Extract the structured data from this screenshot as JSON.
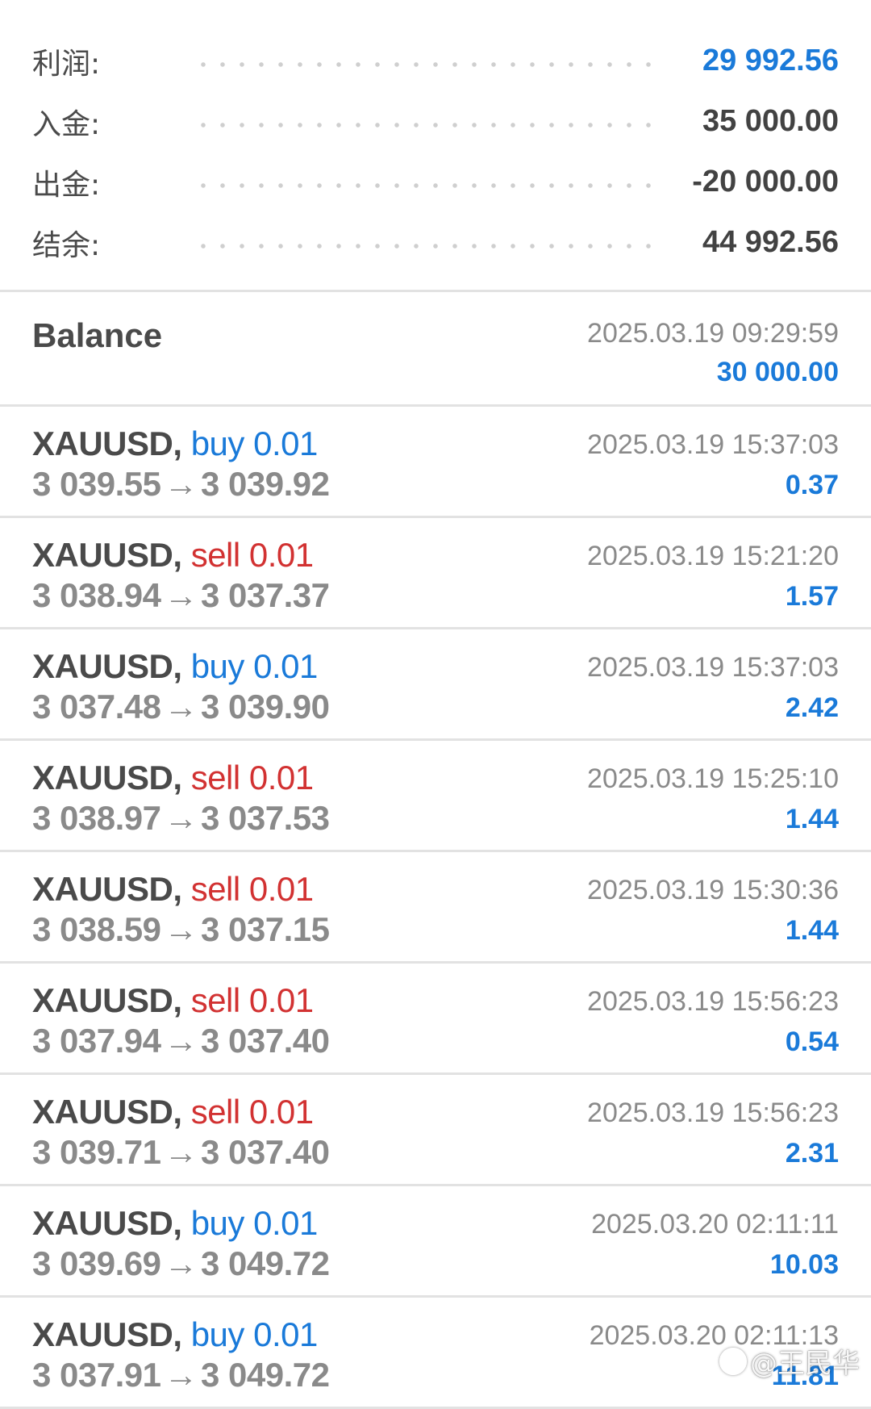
{
  "summary": [
    {
      "label": "利润:",
      "value": "29 992.56",
      "accent": true
    },
    {
      "label": "入金:",
      "value": "35 000.00",
      "accent": false
    },
    {
      "label": "出金:",
      "value": "-20 000.00",
      "accent": false
    },
    {
      "label": "结余:",
      "value": "44 992.56",
      "accent": false
    }
  ],
  "balance": {
    "title": "Balance",
    "datetime": "2025.03.19 09:29:59",
    "amount": "30 000.00"
  },
  "deals": [
    {
      "symbol": "XAUUSD,",
      "direction": "buy",
      "volume": "0.01",
      "open": "3 039.55",
      "close": "3 039.92",
      "datetime": "2025.03.19 15:37:03",
      "profit": "0.37"
    },
    {
      "symbol": "XAUUSD,",
      "direction": "sell",
      "volume": "0.01",
      "open": "3 038.94",
      "close": "3 037.37",
      "datetime": "2025.03.19 15:21:20",
      "profit": "1.57"
    },
    {
      "symbol": "XAUUSD,",
      "direction": "buy",
      "volume": "0.01",
      "open": "3 037.48",
      "close": "3 039.90",
      "datetime": "2025.03.19 15:37:03",
      "profit": "2.42"
    },
    {
      "symbol": "XAUUSD,",
      "direction": "sell",
      "volume": "0.01",
      "open": "3 038.97",
      "close": "3 037.53",
      "datetime": "2025.03.19 15:25:10",
      "profit": "1.44"
    },
    {
      "symbol": "XAUUSD,",
      "direction": "sell",
      "volume": "0.01",
      "open": "3 038.59",
      "close": "3 037.15",
      "datetime": "2025.03.19 15:30:36",
      "profit": "1.44"
    },
    {
      "symbol": "XAUUSD,",
      "direction": "sell",
      "volume": "0.01",
      "open": "3 037.94",
      "close": "3 037.40",
      "datetime": "2025.03.19 15:56:23",
      "profit": "0.54"
    },
    {
      "symbol": "XAUUSD,",
      "direction": "sell",
      "volume": "0.01",
      "open": "3 039.71",
      "close": "3 037.40",
      "datetime": "2025.03.19 15:56:23",
      "profit": "2.31"
    },
    {
      "symbol": "XAUUSD,",
      "direction": "buy",
      "volume": "0.01",
      "open": "3 039.69",
      "close": "3 049.72",
      "datetime": "2025.03.20 02:11:11",
      "profit": "10.03"
    },
    {
      "symbol": "XAUUSD,",
      "direction": "buy",
      "volume": "0.01",
      "open": "3 037.91",
      "close": "3 049.72",
      "datetime": "2025.03.20 02:11:13",
      "profit": "11.81"
    }
  ],
  "arrow_glyph": "→",
  "watermark": "@王民华",
  "colors": {
    "accent_blue": "#1a7ad9",
    "sell_red": "#d23232",
    "text_dark": "#4a4a4a",
    "text_grey": "#8a8a8a",
    "divider": "#e2e2e2"
  }
}
